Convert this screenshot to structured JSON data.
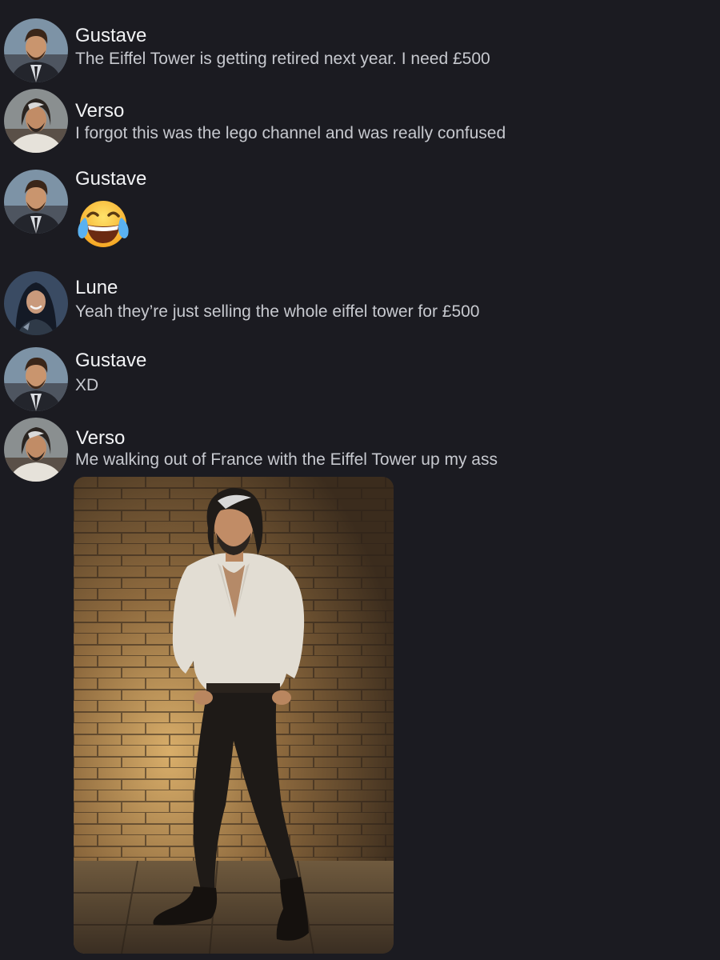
{
  "colors": {
    "background": "#1b1b21",
    "username": "#f2f3f5",
    "message_text": "#c7c9cf"
  },
  "messages": [
    {
      "username": "Gustave",
      "avatar": "gustave-avatar",
      "text": "The Eiffel Tower is getting retired next year. I need £500"
    },
    {
      "username": "Verso",
      "avatar": "verso-avatar",
      "text": "I forgot this was the lego channel and was really confused"
    },
    {
      "username": "Gustave",
      "avatar": "gustave-avatar",
      "emoji": "face-with-tears-of-joy-emoji"
    },
    {
      "username": "Lune",
      "avatar": "lune-avatar",
      "text": "Yeah they’re just selling the whole eiffel tower for £500"
    },
    {
      "username": "Gustave",
      "avatar": "gustave-avatar",
      "text": "XD"
    },
    {
      "username": "Verso",
      "avatar": "verso-avatar",
      "text": "Me walking out of France with the Eiffel Tower up my ass",
      "attachment": "photo-man-posing-brick-wall"
    }
  ]
}
